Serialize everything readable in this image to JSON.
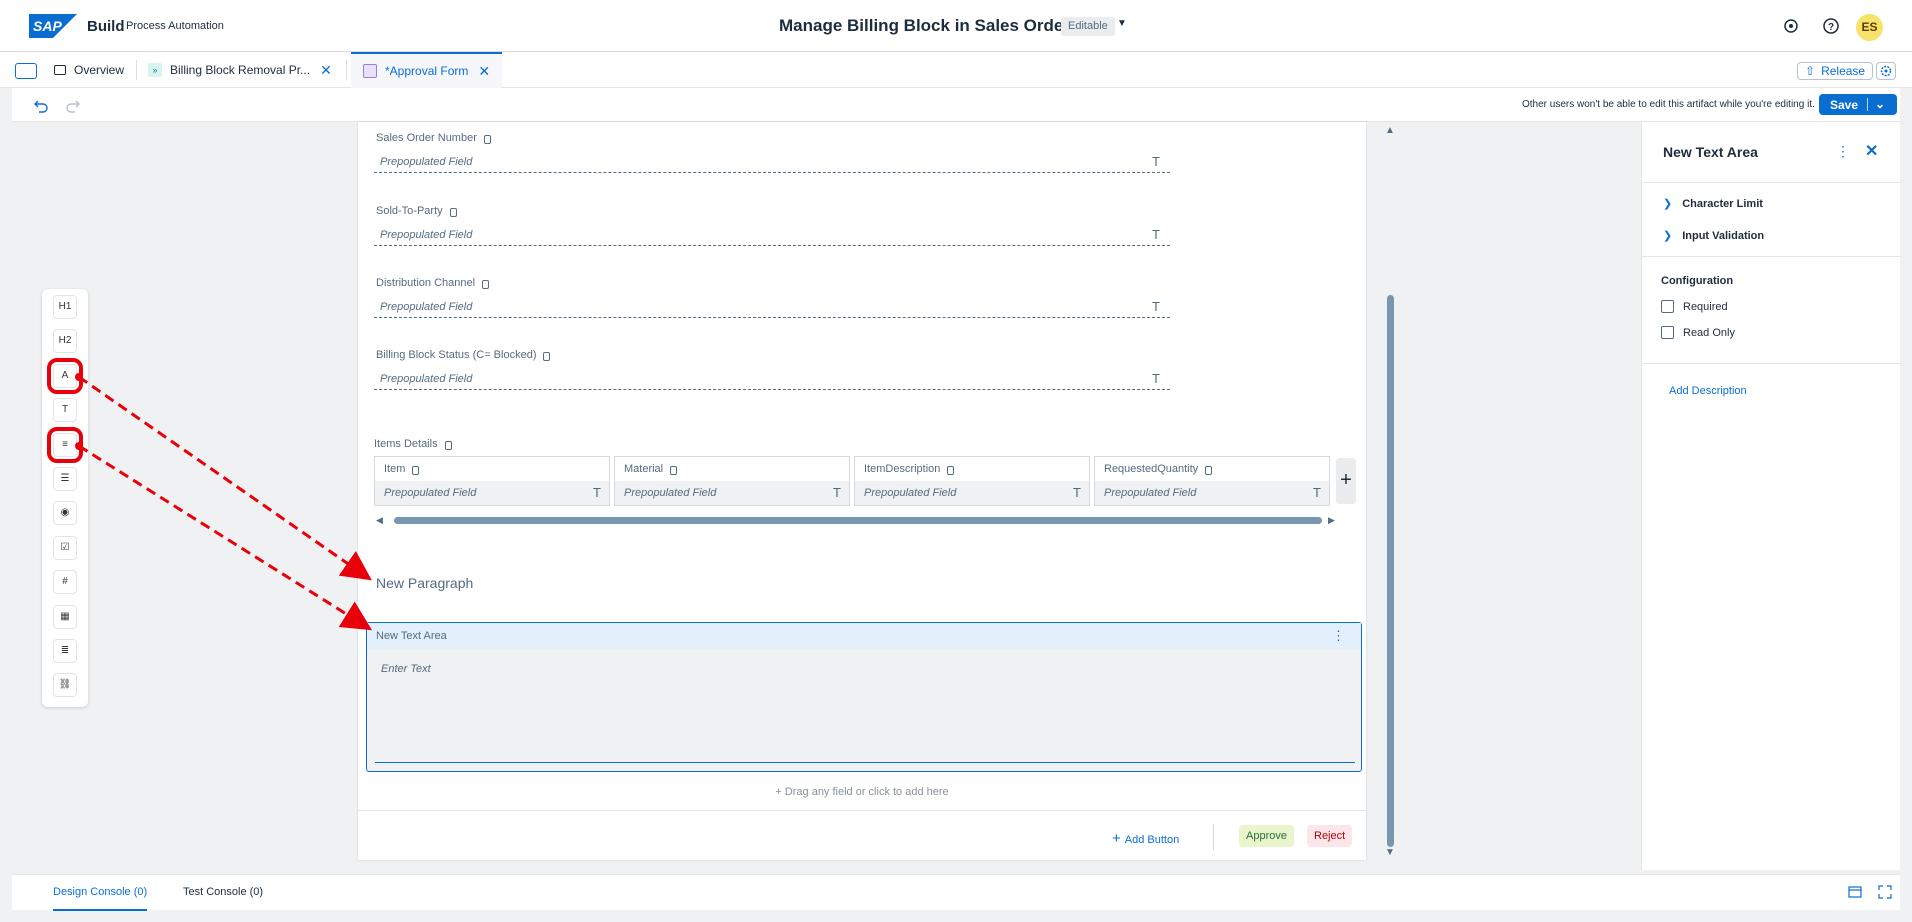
{
  "shell": {
    "logo_text": "SAP",
    "product": "Build",
    "subtitle": "Process Automation",
    "title": "Manage Billing Block in Sales Order",
    "status_badge": "Editable",
    "avatar_initials": "ES",
    "icons": [
      "notification-icon",
      "help-icon"
    ]
  },
  "tabs": {
    "items": [
      {
        "label": "Overview",
        "icon": "overview-icon"
      },
      {
        "label": "Billing Block Removal Pr...",
        "icon": "process-icon",
        "closable": true
      },
      {
        "label": "*Approval Form",
        "icon": "form-icon",
        "closable": true,
        "active": true
      }
    ],
    "release_label": "Release"
  },
  "toolbar": {
    "edit_note": "Other users won't be able to edit this artifact while you're editing it.",
    "save_label": "Save"
  },
  "palette": {
    "items": [
      {
        "label": "H1",
        "icon": "heading1-icon"
      },
      {
        "label": "H2",
        "icon": "heading2-icon"
      },
      {
        "label": "A",
        "icon": "paragraph-icon",
        "highlighted": true
      },
      {
        "label": "T",
        "icon": "text-field-icon"
      },
      {
        "label": "≡",
        "icon": "text-area-icon",
        "highlighted": true
      },
      {
        "label": "☰",
        "icon": "checklist-icon"
      },
      {
        "label": "◉",
        "icon": "radio-icon"
      },
      {
        "label": "☑",
        "icon": "checkbox-icon"
      },
      {
        "label": "#",
        "icon": "number-icon"
      },
      {
        "label": "▦",
        "icon": "date-icon"
      },
      {
        "label": "≣",
        "icon": "dropdown-icon"
      },
      {
        "label": "⛓",
        "icon": "link-icon"
      }
    ]
  },
  "form": {
    "fields": [
      {
        "label": "Sales Order Number",
        "placeholder": "Prepopulated Field"
      },
      {
        "label": "Sold-To-Party",
        "placeholder": "Prepopulated Field"
      },
      {
        "label": "Distribution Channel",
        "placeholder": "Prepopulated Field"
      },
      {
        "label": "Billing Block Status (C= Blocked)",
        "placeholder": "Prepopulated Field"
      }
    ],
    "table": {
      "label": "Items Details",
      "columns": [
        "Item",
        "Material",
        "ItemDescription",
        "RequestedQuantity"
      ],
      "cell_placeholder": "Prepopulated Field"
    },
    "paragraph": "New Paragraph",
    "textarea": {
      "label": "New Text Area",
      "placeholder": "Enter Text"
    },
    "drag_hint": "Drag any field or click to add here",
    "add_button": "Add Button",
    "approve": "Approve",
    "reject": "Reject",
    "colors": {
      "accent": "#0a6ed1",
      "highlight": "#e8000b"
    }
  },
  "panel": {
    "title": "New Text Area",
    "sections": [
      "Character Limit",
      "Input Validation"
    ],
    "config_title": "Configuration",
    "checkboxes": [
      {
        "label": "Required",
        "checked": false
      },
      {
        "label": "Read Only",
        "checked": false
      }
    ],
    "add_description": "Add Description"
  },
  "console": {
    "tabs": [
      "Design Console (0)",
      "Test Console (0)"
    ]
  }
}
